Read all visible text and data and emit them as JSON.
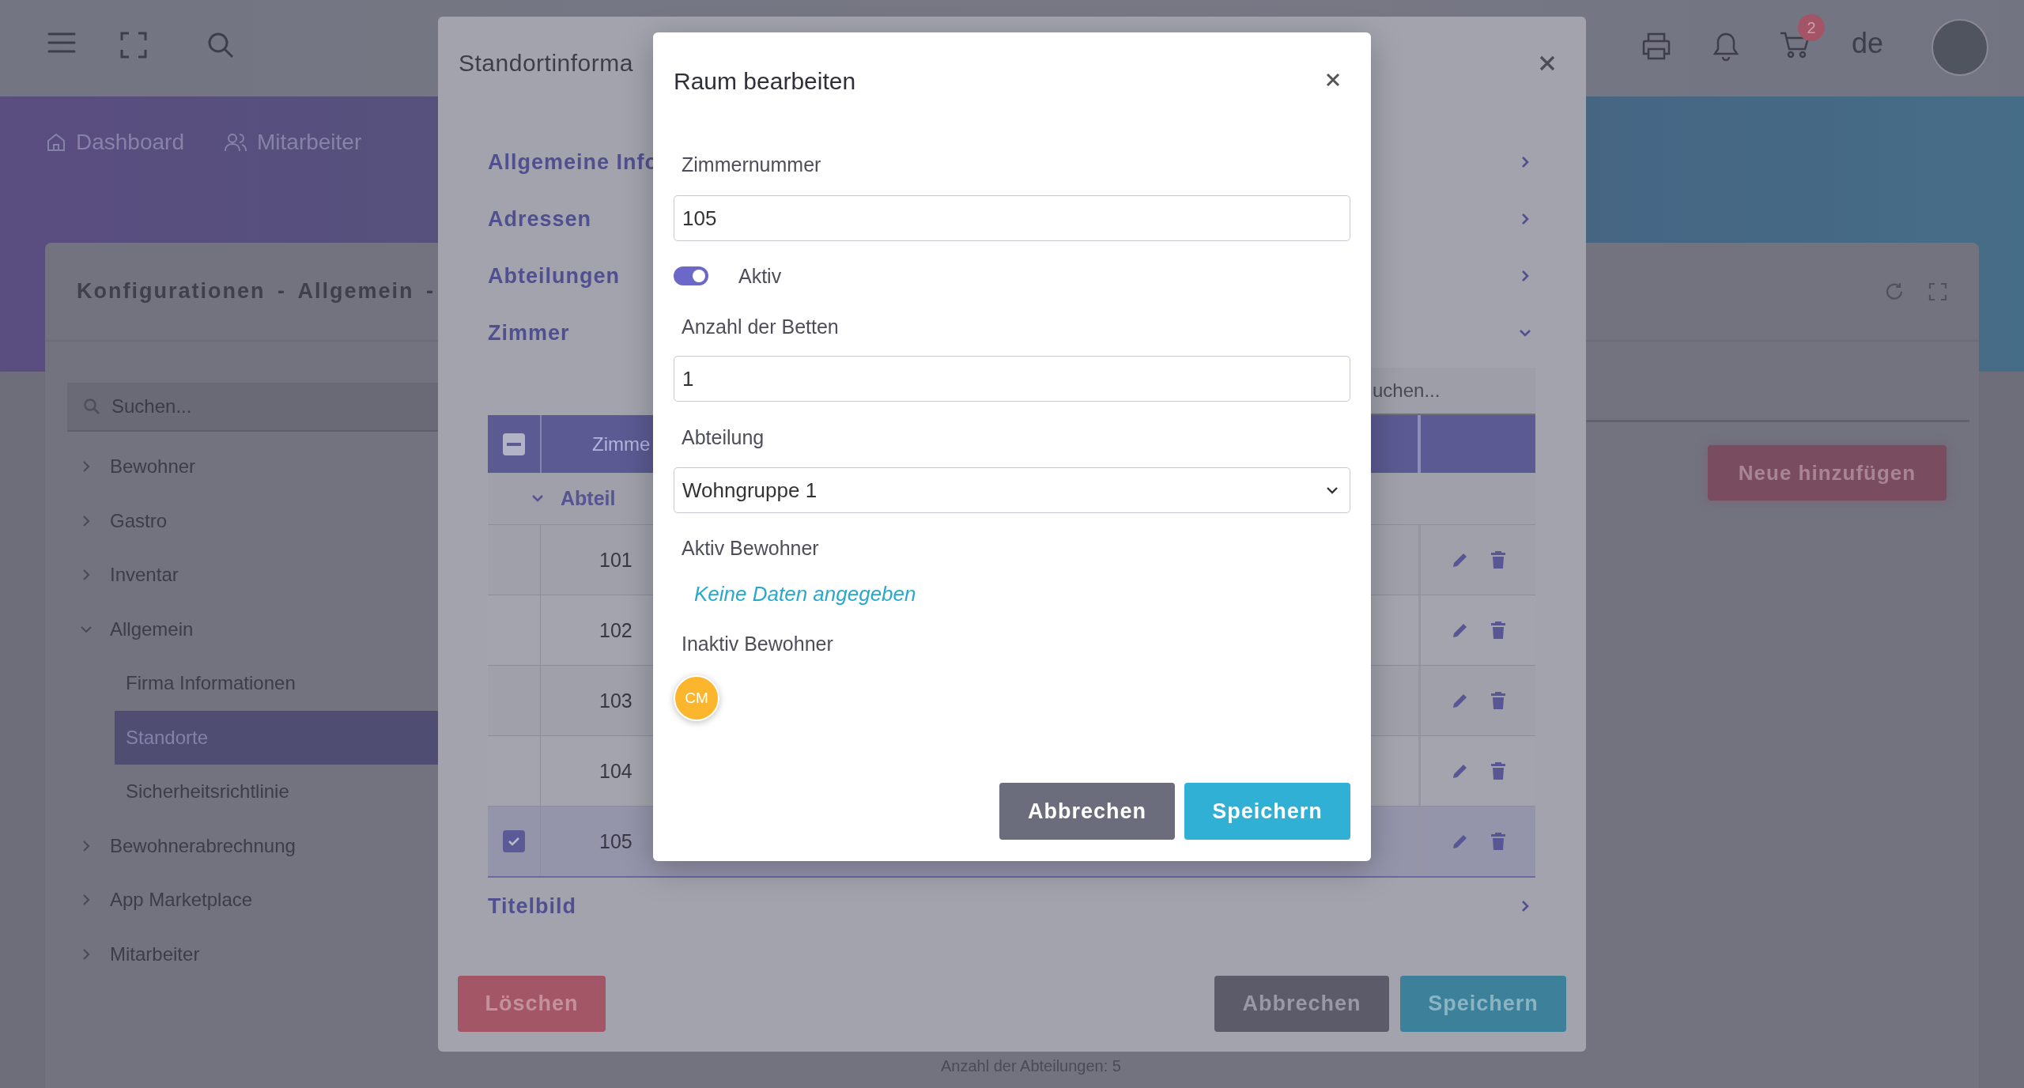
{
  "top_bar": {
    "cart_badge": "2",
    "language": "de"
  },
  "nav": [
    {
      "label": "Dashboard",
      "kind": "home"
    },
    {
      "label": "Mitarbeiter",
      "kind": "users"
    }
  ],
  "card": {
    "title": "Konfigurationen - Allgemein -",
    "add_button": "Neue hinzufügen",
    "footer_text": "Anzahl der Abteilungen:  5"
  },
  "sidebar": {
    "search_placeholder": "Suchen...",
    "items": [
      {
        "label": "Bewohner",
        "expanded": false,
        "selected": false
      },
      {
        "label": "Gastro",
        "expanded": false,
        "selected": false
      },
      {
        "label": "Inventar",
        "expanded": false,
        "selected": false
      },
      {
        "label": "Allgemein",
        "expanded": true,
        "selected": false,
        "children": [
          {
            "label": "Firma Informationen",
            "selected": false
          },
          {
            "label": "Standorte",
            "selected": true
          },
          {
            "label": "Sicherheitsrichtlinie",
            "selected": false
          }
        ]
      },
      {
        "label": "Bewohnerabrechnung",
        "expanded": false,
        "selected": false
      },
      {
        "label": "App Marketplace",
        "expanded": false,
        "selected": false
      },
      {
        "label": "Mitarbeiter",
        "expanded": false,
        "selected": false
      }
    ]
  },
  "location_dialog": {
    "title": "Standortinforma",
    "sections": [
      {
        "label": "Allgemeine Info",
        "expanded": false
      },
      {
        "label": "Adressen",
        "expanded": false
      },
      {
        "label": "Abteilungen",
        "expanded": false
      },
      {
        "label": "Zimmer",
        "expanded": true
      },
      {
        "label": "Titelbild",
        "expanded": false
      }
    ],
    "search_placeholder": "uchen...",
    "table": {
      "header_checkbox": {
        "checked": true,
        "indeterminate": true
      },
      "column_1": "Zimme",
      "group": {
        "label": "Abteil",
        "expanded": true
      },
      "rows": [
        {
          "number": "101",
          "checked": false
        },
        {
          "number": "102",
          "checked": false
        },
        {
          "number": "103",
          "checked": false
        },
        {
          "number": "104",
          "checked": false
        },
        {
          "number": "105",
          "checked": true
        }
      ]
    },
    "buttons": {
      "delete": "Löschen",
      "cancel": "Abbrechen",
      "save": "Speichern"
    }
  },
  "room_dialog": {
    "title": "Raum bearbeiten",
    "room_number": {
      "label": "Zimmernummer",
      "value": "105"
    },
    "active": {
      "label": "Aktiv",
      "on": true
    },
    "beds": {
      "label": "Anzahl der Betten",
      "value": "1"
    },
    "department": {
      "label": "Abteilung",
      "value": "Wohngruppe 1"
    },
    "active_residents": {
      "label": "Aktiv Bewohner",
      "empty_text": "Keine Daten angegeben"
    },
    "inactive_residents": {
      "label": "Inaktiv Bewohner",
      "residents": [
        {
          "initials": "CM",
          "color": "#fbb62d"
        }
      ]
    },
    "buttons": {
      "cancel": "Abbrechen",
      "save": "Speichern"
    }
  }
}
